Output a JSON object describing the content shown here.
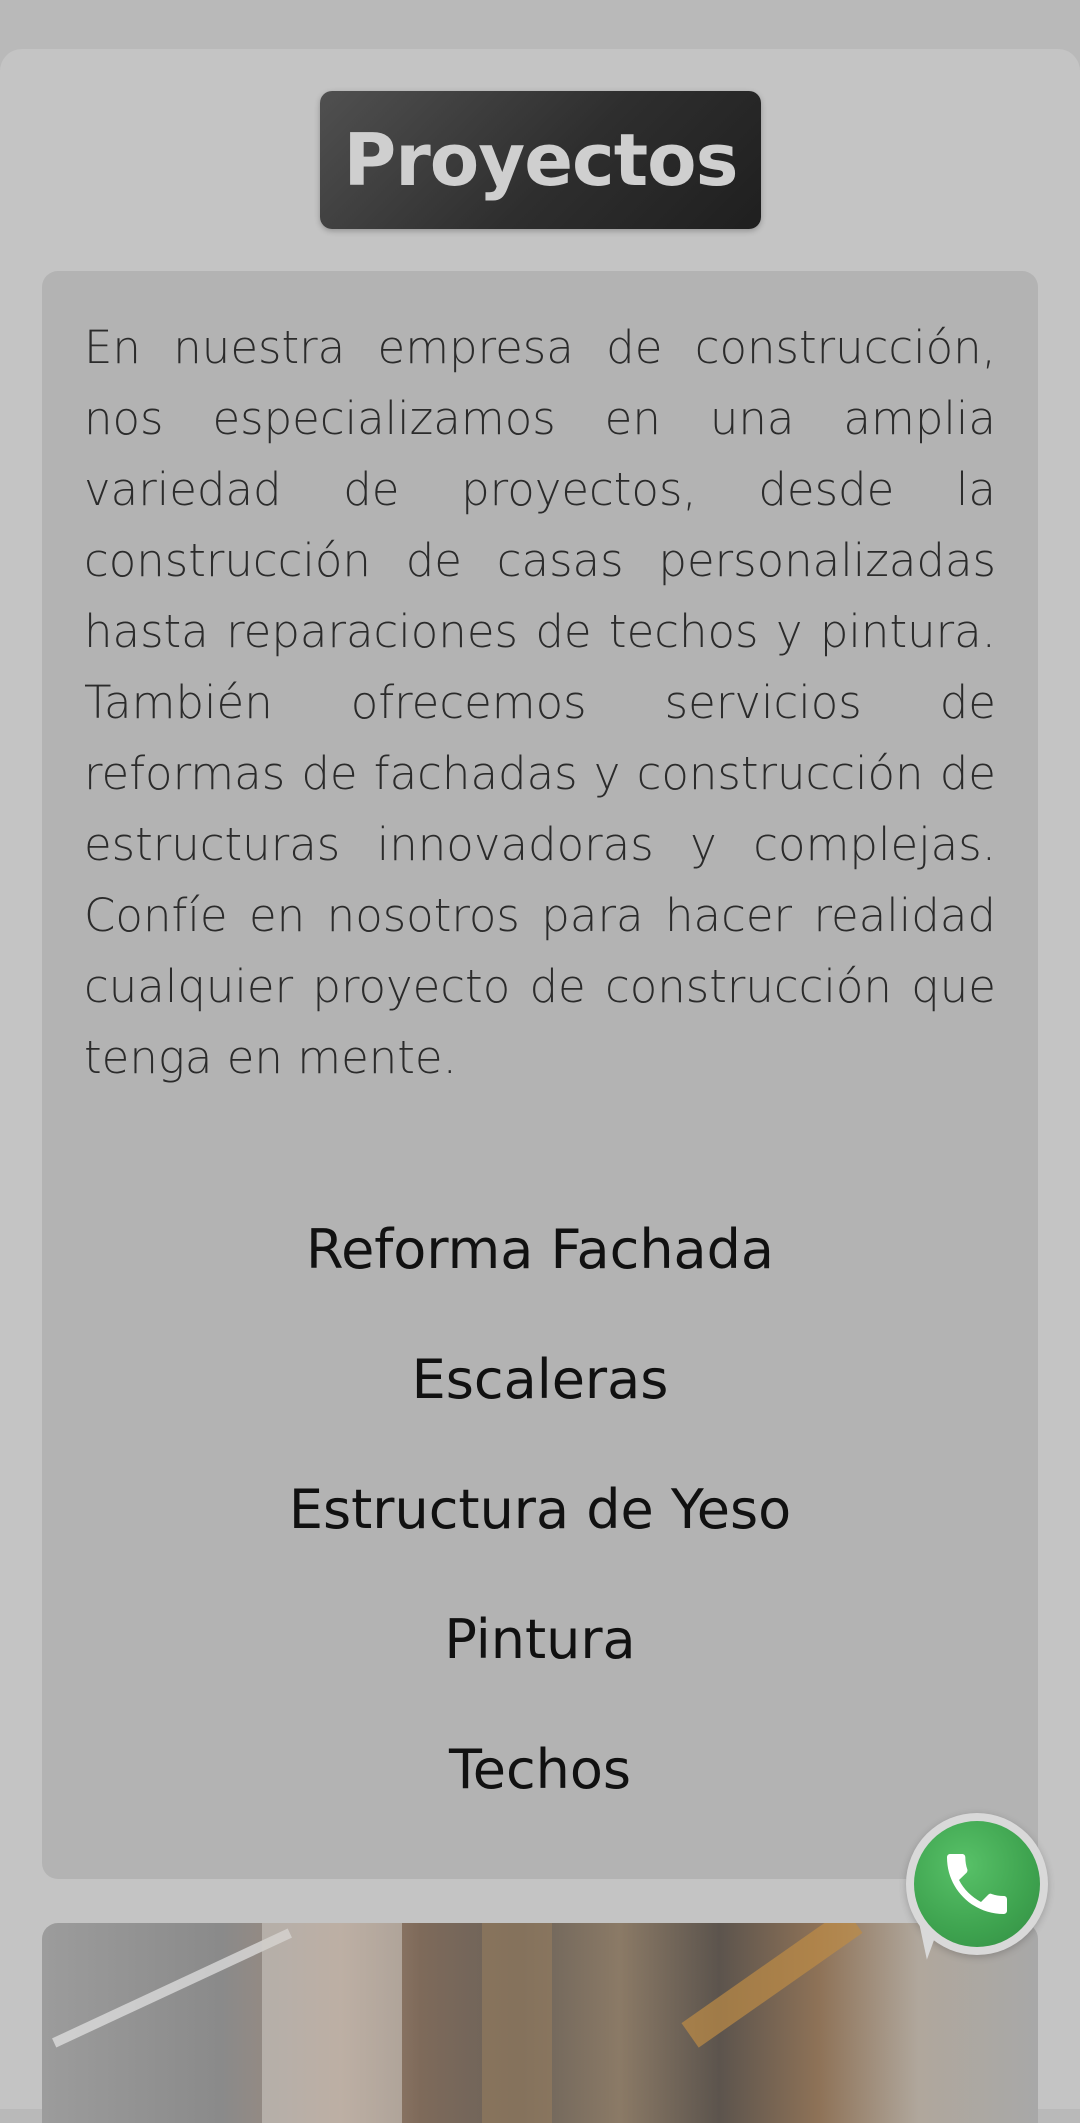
{
  "section": {
    "title": "Proyectos",
    "intro": "En nuestra empresa de construcción, nos especializamos en una amplia variedad de proyectos, desde la construcción de casas personalizadas hasta reparaciones de techos y pintura. También ofrecemos servicios de reformas de fachadas y construcción de estructuras innovadoras y complejas. Confíe en nosotros para hacer realidad cualquier proyecto de construcción que tenga en mente."
  },
  "projects": [
    {
      "label": "Reforma Fachada"
    },
    {
      "label": "Escaleras"
    },
    {
      "label": "Estructura de Yeso"
    },
    {
      "label": "Pintura"
    },
    {
      "label": "Techos"
    }
  ],
  "floating": {
    "icon": "whatsapp-icon"
  },
  "colors": {
    "page_bg": "#b9b9b9",
    "card_bg": "#c4c4c4",
    "panel_bg": "#b3b3b3",
    "title_badge": "#2e2e2e",
    "whatsapp_green": "#3ea34f"
  }
}
